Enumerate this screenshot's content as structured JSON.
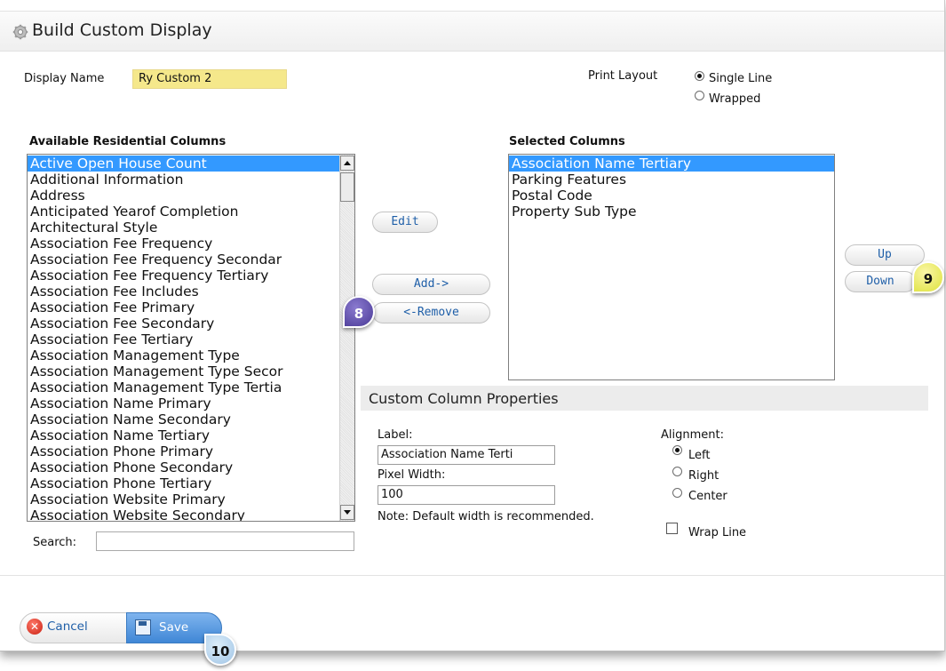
{
  "dialog": {
    "title": "Build Custom Display",
    "title_icon": "gear-icon"
  },
  "display_name": {
    "label": "Display Name",
    "value": "Ry Custom 2"
  },
  "print_layout": {
    "label": "Print Layout",
    "options": [
      "Single Line",
      "Wrapped"
    ],
    "selected": "Single Line"
  },
  "available": {
    "header": "Available Residential Columns",
    "items": [
      "Active Open House Count",
      "Additional Information",
      "Address",
      "Anticipated Yearof Completion",
      "Architectural Style",
      "Association Fee Frequency",
      "Association Fee Frequency Secondar",
      "Association Fee Frequency Tertiary",
      "Association Fee Includes",
      "Association Fee Primary",
      "Association Fee Secondary",
      "Association Fee Tertiary",
      "Association Management Type",
      "Association Management Type Secor",
      "Association Management Type Tertia",
      "Association Name Primary",
      "Association Name Secondary",
      "Association Name Tertiary",
      "Association Phone Primary",
      "Association Phone Secondary",
      "Association Phone Tertiary",
      "Association Website Primary",
      "Association Website Secondary"
    ],
    "selected_index": 0
  },
  "search": {
    "label": "Search:",
    "value": ""
  },
  "buttons": {
    "edit": "Edit",
    "add": "Add->",
    "remove": "<-Remove",
    "up": "Up",
    "down": "Down",
    "cancel": "Cancel",
    "save": "Save"
  },
  "selected_columns": {
    "header": "Selected Columns",
    "items": [
      "Association Name Tertiary",
      "Parking Features",
      "Postal Code",
      "Property Sub Type"
    ],
    "selected_index": 0
  },
  "custom_props": {
    "title": "Custom Column Properties",
    "label_label": "Label:",
    "label_value": "Association Name Terti",
    "pixel_width_label": "Pixel Width:",
    "pixel_width_value": "100",
    "note": "Note: Default width is recommended.",
    "alignment_label": "Alignment:",
    "alignment_options": [
      "Left",
      "Right",
      "Center"
    ],
    "alignment_selected": "Left",
    "wrap_line_label": "Wrap Line",
    "wrap_line_checked": false
  },
  "callouts": [
    "8",
    "9",
    "10"
  ],
  "colors": {
    "selection": "#3399ff",
    "display_name_bg": "#f5e88b",
    "link_blue": "#1f5fa8",
    "save_blue": "#3f87d6"
  }
}
